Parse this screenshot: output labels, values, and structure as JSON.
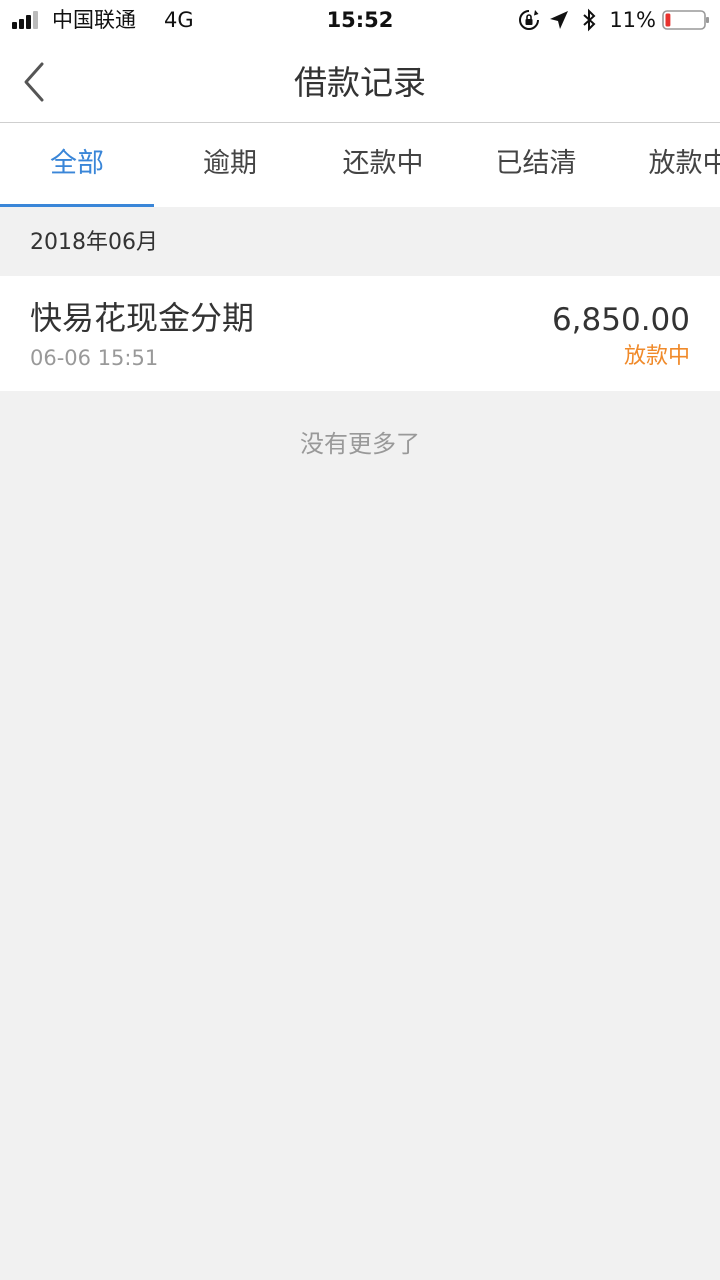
{
  "status_bar": {
    "carrier": "中国联通",
    "network": "4G",
    "time": "15:52",
    "battery_percent": "11%",
    "battery_level": 0.11,
    "icons": [
      "signal-icon",
      "rotation-lock-icon",
      "location-arrow-icon",
      "bluetooth-icon",
      "battery-icon"
    ]
  },
  "nav": {
    "title": "借款记录",
    "back_icon": "chevron-left-icon"
  },
  "tabs": [
    {
      "label": "全部",
      "active": true
    },
    {
      "label": "逾期",
      "active": false
    },
    {
      "label": "还款中",
      "active": false
    },
    {
      "label": "已结清",
      "active": false
    },
    {
      "label": "放款中",
      "active": false
    }
  ],
  "month": "2018年06月",
  "record": {
    "name": "快易花现金分期",
    "time": "06-06 15:51",
    "amount": "6,850.00",
    "status": "放款中"
  },
  "footer": {
    "no_more": "没有更多了"
  },
  "colors": {
    "accent": "#3a86d8",
    "status_orange": "#f08a2a",
    "background": "#f1f1f1",
    "battery_low": "#e8322e"
  }
}
